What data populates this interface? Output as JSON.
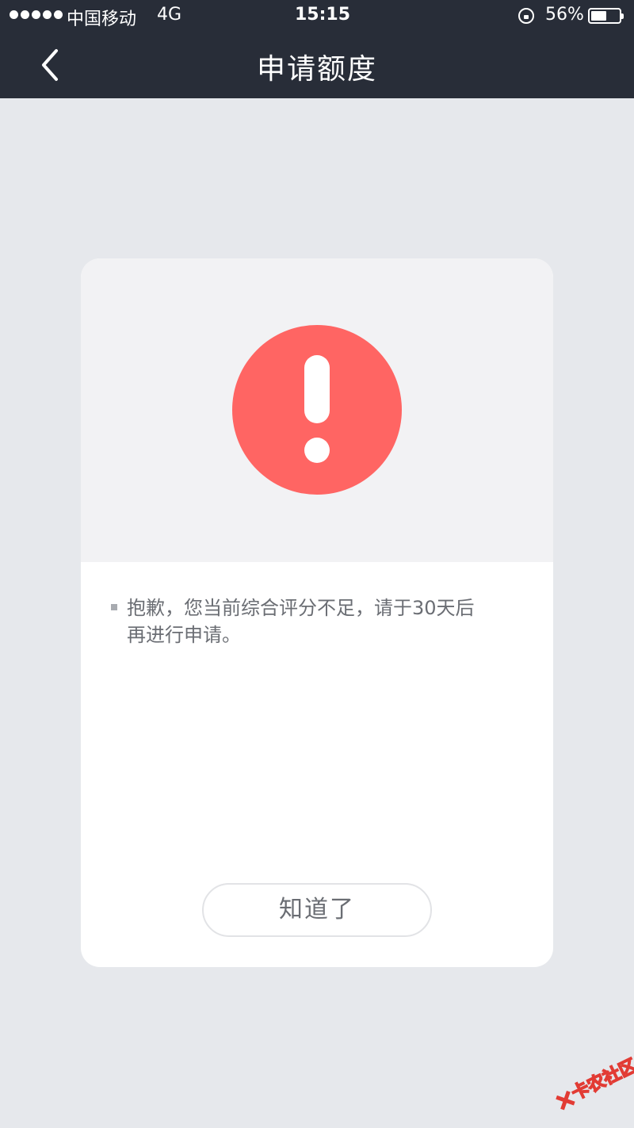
{
  "status_bar": {
    "carrier": "中国移动",
    "network": "4G",
    "time": "15:15",
    "battery_percent": "56%",
    "battery_level": 0.56,
    "signal_bars": 5
  },
  "nav": {
    "title": "申请额度",
    "back_icon": "chevron-left-icon"
  },
  "dialog": {
    "icon": "exclamation-alert-icon",
    "icon_color": "#ff6563",
    "message_line1": "抱歉，您当前综合评分不足，请于30天后",
    "message_line2": "再进行申请。",
    "confirm_label": "知道了"
  },
  "watermark": {
    "text": "卡农社区",
    "color": "#e23b34"
  },
  "colors": {
    "header_bg": "#282d38",
    "page_bg": "#e6e8ec",
    "card_top_bg": "#f2f2f4"
  }
}
